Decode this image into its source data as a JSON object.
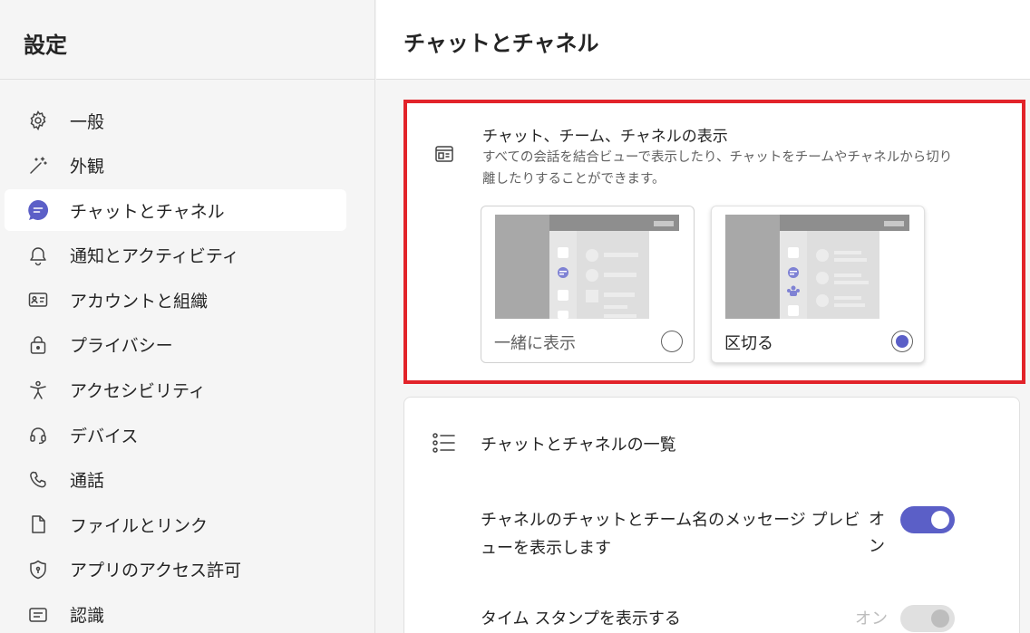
{
  "sidebar": {
    "title": "設定",
    "items": [
      {
        "label": "一般",
        "icon": "gear-icon"
      },
      {
        "label": "外観",
        "icon": "magic-wand-icon"
      },
      {
        "label": "チャットとチャネル",
        "icon": "chat-icon",
        "selected": true
      },
      {
        "label": "通知とアクティビティ",
        "icon": "bell-icon"
      },
      {
        "label": "アカウントと組織",
        "icon": "contact-card-icon"
      },
      {
        "label": "プライバシー",
        "icon": "lock-icon"
      },
      {
        "label": "アクセシビリティ",
        "icon": "accessibility-icon"
      },
      {
        "label": "デバイス",
        "icon": "headset-icon"
      },
      {
        "label": "通話",
        "icon": "phone-icon"
      },
      {
        "label": "ファイルとリンク",
        "icon": "document-icon"
      },
      {
        "label": "アプリのアクセス許可",
        "icon": "shield-icon"
      },
      {
        "label": "認識",
        "icon": "text-box-icon"
      }
    ]
  },
  "main": {
    "title": "チャットとチャネル",
    "display_card": {
      "title": "チャット、チーム、チャネルの表示",
      "description": "すべての会話を結合ビューで表示したり、チャットをチームやチャネルから切り離したりすることができます。",
      "options": [
        {
          "label": "一緒に表示",
          "selected": false
        },
        {
          "label": "区切る",
          "selected": true
        }
      ]
    },
    "list_card": {
      "title": "チャットとチャネルの一覧",
      "settings": [
        {
          "label": "チャネルのチャットとチーム名のメッセージ プレビューを表示します",
          "state": "オン",
          "on": true,
          "disabled": false
        },
        {
          "label": "タイム スタンプを表示する",
          "state": "オン",
          "on": true,
          "disabled": true
        }
      ]
    }
  },
  "colors": {
    "accent": "#5b5fc7",
    "highlight_border": "#e2232a"
  }
}
